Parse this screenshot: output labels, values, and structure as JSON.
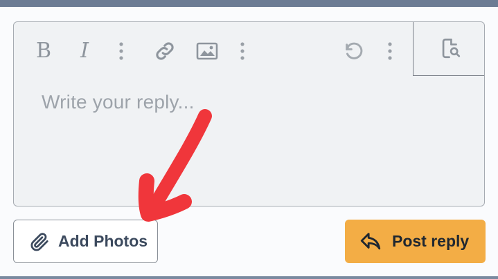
{
  "editor": {
    "toolbar": {
      "bold_label": "B",
      "italic_label": "I",
      "icons": [
        "bold-icon",
        "italic-icon",
        "more-options-icon",
        "link-icon",
        "image-icon",
        "more-options-icon",
        "undo-icon",
        "more-options-icon",
        "preview-icon"
      ]
    },
    "placeholder": "Write your reply..."
  },
  "actions": {
    "add_photos_label": "Add Photos",
    "post_reply_label": "Post reply"
  },
  "colors": {
    "post_reply_bg": "#f3ad45",
    "annotation_arrow": "#f0363b",
    "editor_bg": "#f0f2f4",
    "top_bar": "#6c7c94"
  }
}
